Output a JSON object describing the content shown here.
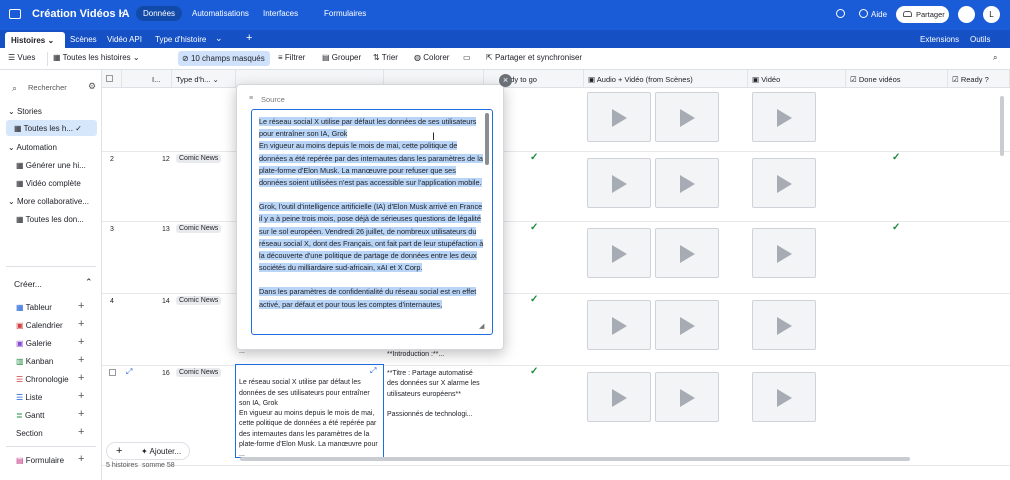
{
  "app": {
    "title": "Création Vidéos IA",
    "title_caret": "⌄",
    "nav": [
      "Données",
      "Automatisations",
      "Interfaces",
      "Formulaires"
    ],
    "help": "Aide",
    "share": "Partager",
    "avatar": "L"
  },
  "tabs": {
    "items": [
      "Histoires",
      "Scènes",
      "Vidéo API",
      "Type d'histoire"
    ],
    "right": [
      "Extensions",
      "Outils"
    ]
  },
  "toolbar": {
    "views": "Vues",
    "current_view": "Toutes les histoires",
    "hidden_fields": "10 champs masqués",
    "filter": "Filtrer",
    "group": "Grouper",
    "sort": "Trier",
    "color": "Colorer",
    "share_sync": "Partager et synchroniser"
  },
  "sidebar": {
    "search": "Rechercher",
    "sections": [
      {
        "title": "Stories",
        "items": [
          "Toutes les h..."
        ]
      },
      {
        "title": "Automation",
        "items": [
          "Générer une hi...",
          "Vidéo complète"
        ]
      },
      {
        "title": "More collaborative...",
        "items": [
          "Toutes les don..."
        ]
      }
    ],
    "create_title": "Créer...",
    "create_items": [
      "Tableur",
      "Calendrier",
      "Galerie",
      "Kanban",
      "Chronologie",
      "Liste",
      "Gantt",
      "Section"
    ],
    "form": "Formulaire"
  },
  "grid": {
    "headers": [
      "I...",
      "Type d'h...",
      "...dy to go",
      "Audio + Vidéo (from Scènes)",
      "Vidéo",
      "Done vidéos",
      "Ready ?"
    ],
    "rows": [
      {
        "num": "2",
        "id": "12",
        "type": "Comic News"
      },
      {
        "num": "3",
        "id": "13",
        "type": "Comic News"
      },
      {
        "num": "4",
        "id": "14",
        "type": "Comic News"
      },
      {
        "num": "",
        "id": "16",
        "type": "Comic News"
      }
    ],
    "row5_source": "Le réseau social X utilise par défaut les données de ses utilisateurs pour entraîner son IA, Grok\nEn vigueur au moins depuis le mois de mai, cette politique de données a été repérée par des internautes dans les paramètres de la plate-forme d'Elon Musk. La manœuvre pour ...",
    "row5_title": "**Titre : Partage automatisé des données sur X alarme les utilisateurs européens**",
    "row5_passion": "Passionnés de technologi...",
    "row4_intro": "**Introduction :**...",
    "ellipsis": "...",
    "footer_count": "5 histoires",
    "footer_sum": "somme 58",
    "add_label": "Ajouter..."
  },
  "popup": {
    "label": "Source",
    "paragraphs": [
      "Le réseau social X utilise par défaut les données de ses utilisateurs pour entraîner son IA, Grok\nEn vigueur au moins depuis le mois de mai, cette politique de données a été repérée par des internautes dans les paramètres de la plate-forme d'Elon Musk. La manœuvre pour refuser que ses données soient utilisées n'est pas accessible sur l'application mobile.",
      "Grok, l'outil d'intelligence artificielle (IA) d'Elon Musk arrivé en France il y a à peine trois mois, pose déjà de sérieuses questions de légalité sur le sol européen. Vendredi 26 juillet, de nombreux utilisateurs du réseau social X, dont des Français, ont fait part de leur stupéfaction à la découverte d'une politique de partage de données entre les deux sociétés du milliardaire sud-africain, xAI et X Corp.",
      "Dans les paramètres de confidentialité du réseau social est en effet activé, par défaut et pour tous les comptes d'internautes,"
    ]
  },
  "colors": {
    "topbar": "#1a5cd8",
    "tabbar": "#1550c4",
    "selection": "#b8d4f6",
    "check": "#1f8a3d",
    "focus": "#1d6fe0"
  }
}
